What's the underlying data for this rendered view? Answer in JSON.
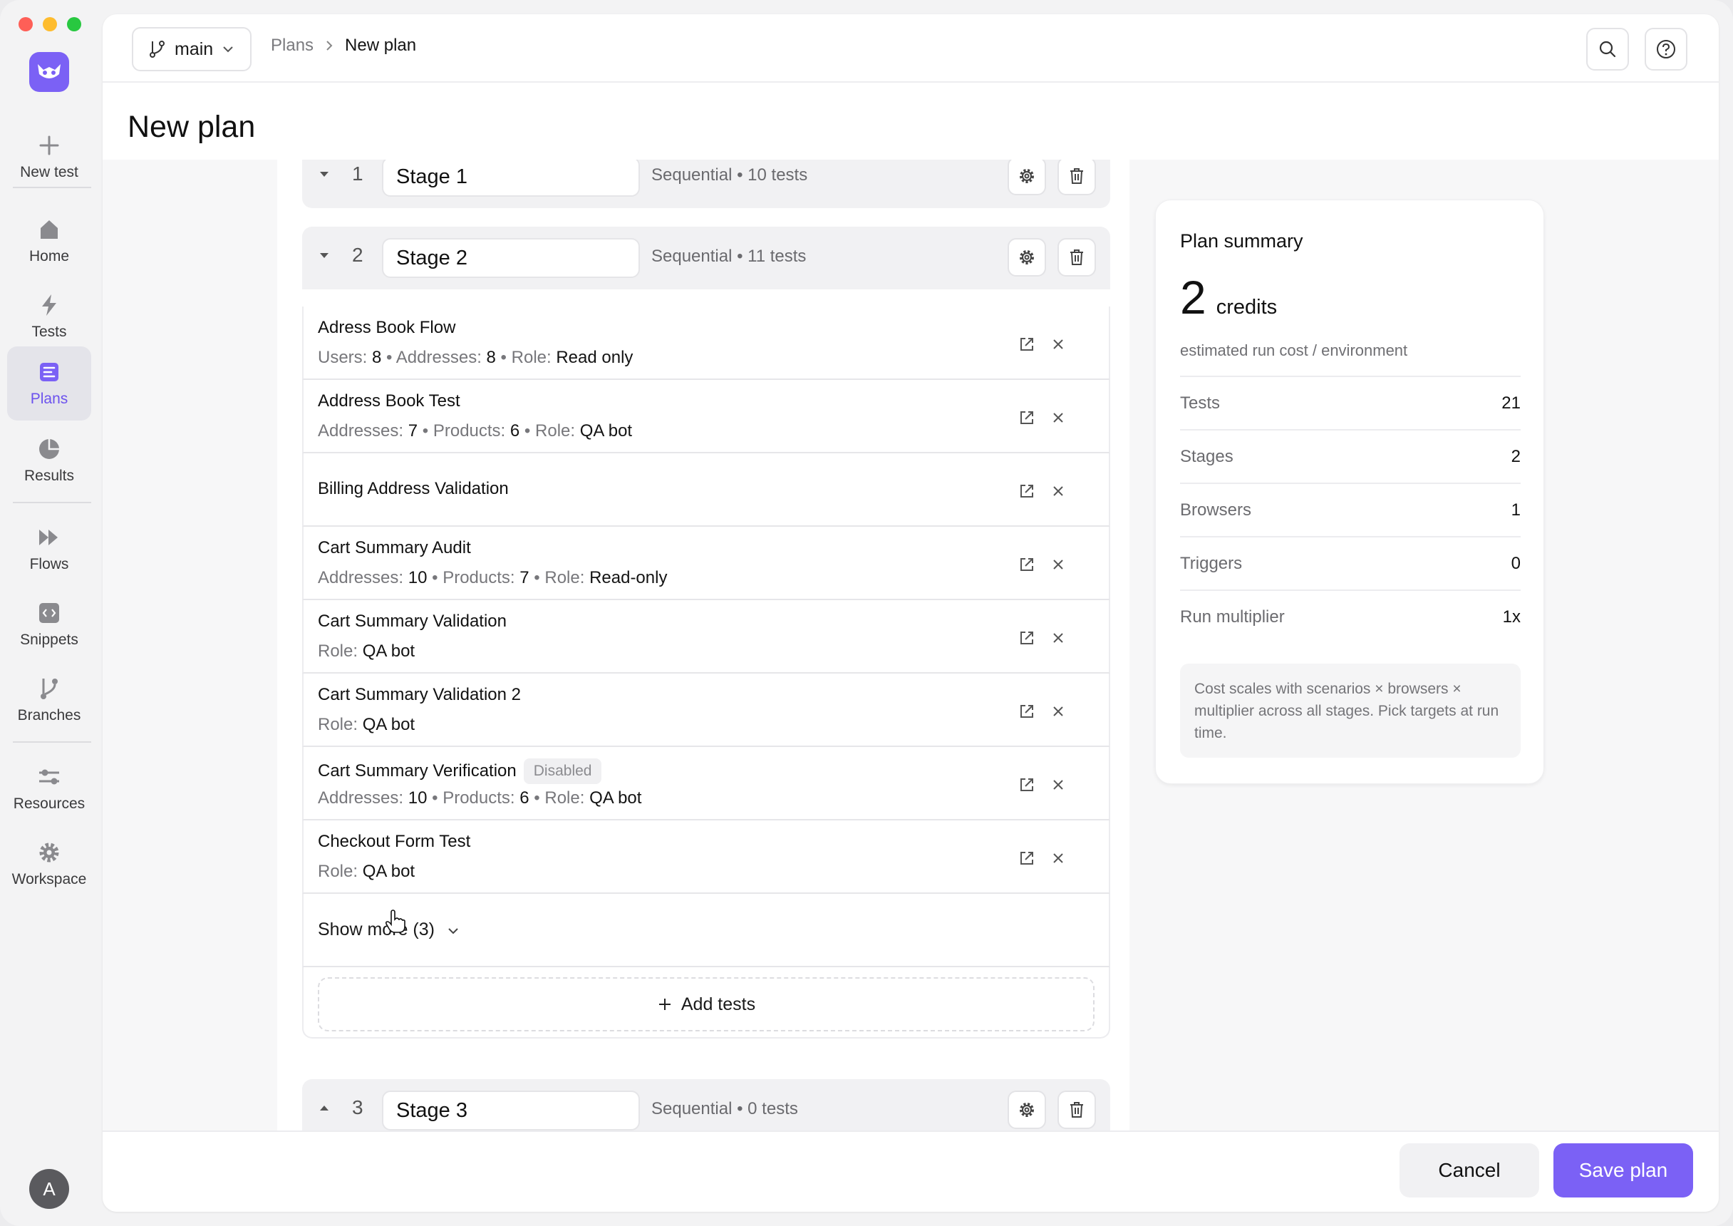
{
  "colors": {
    "accent": "#7b61f5",
    "accent_text": "#6c52ee"
  },
  "sidebar": {
    "new_test": "New test",
    "items": [
      {
        "label": "Home",
        "icon": "home-icon"
      },
      {
        "label": "Tests",
        "icon": "lightning-icon"
      },
      {
        "label": "Plans",
        "icon": "plans-icon",
        "active": true
      },
      {
        "label": "Results",
        "icon": "pie-chart-icon"
      },
      {
        "label": "Flows",
        "icon": "fast-forward-icon"
      },
      {
        "label": "Snippets",
        "icon": "code-icon"
      },
      {
        "label": "Branches",
        "icon": "branch-icon"
      },
      {
        "label": "Resources",
        "icon": "sliders-icon"
      },
      {
        "label": "Workspace",
        "icon": "gear-icon"
      }
    ],
    "avatar": "A"
  },
  "topbar": {
    "branch": "main",
    "breadcrumb": [
      "Plans",
      "New plan"
    ]
  },
  "page": {
    "title": "New plan"
  },
  "stages": [
    {
      "num": "1",
      "name": "Stage 1",
      "meta": "Sequential • 10 tests"
    },
    {
      "num": "2",
      "name": "Stage 2",
      "meta": "Sequential • 11 tests"
    },
    {
      "num": "3",
      "name": "Stage 3",
      "meta": "Sequential • 0 tests"
    }
  ],
  "tests": [
    {
      "name": "Adress Book Flow",
      "parts": [
        [
          "Users:",
          "8"
        ],
        [
          "Addresses:",
          "8"
        ],
        [
          "Role:",
          "Read only"
        ]
      ]
    },
    {
      "name": "Address Book Test",
      "parts": [
        [
          "Addresses:",
          "7"
        ],
        [
          "Products:",
          "6"
        ],
        [
          "Role:",
          "QA bot"
        ]
      ]
    },
    {
      "name": "Billing Address Validation",
      "parts": []
    },
    {
      "name": "Cart Summary Audit",
      "parts": [
        [
          "Addresses:",
          "10"
        ],
        [
          "Products:",
          "7"
        ],
        [
          "Role:",
          "Read-only"
        ]
      ]
    },
    {
      "name": "Cart Summary Validation",
      "parts": [
        [
          "Role:",
          "QA bot"
        ]
      ]
    },
    {
      "name": "Cart Summary Validation 2",
      "parts": [
        [
          "Role:",
          "QA bot"
        ]
      ]
    },
    {
      "name": "Cart Summary Verification",
      "badge": "Disabled",
      "parts": [
        [
          "Addresses:",
          "10"
        ],
        [
          "Products:",
          "6"
        ],
        [
          "Role:",
          "QA bot"
        ]
      ]
    },
    {
      "name": "Checkout Form Test",
      "parts": [
        [
          "Role:",
          "QA bot"
        ]
      ]
    }
  ],
  "show_more": "Show more (3)",
  "add_tests": "Add tests",
  "summary": {
    "title": "Plan summary",
    "credits_value": "2",
    "credits_unit": "credits",
    "subtitle": "estimated run cost / environment",
    "rows": [
      {
        "label": "Tests",
        "value": "21"
      },
      {
        "label": "Stages",
        "value": "2"
      },
      {
        "label": "Browsers",
        "value": "1"
      },
      {
        "label": "Triggers",
        "value": "0"
      },
      {
        "label": "Run multiplier",
        "value": "1x"
      }
    ],
    "note": "Cost scales with scenarios × browsers × multiplier across all stages. Pick targets at run time."
  },
  "footer": {
    "cancel": "Cancel",
    "save": "Save plan"
  }
}
